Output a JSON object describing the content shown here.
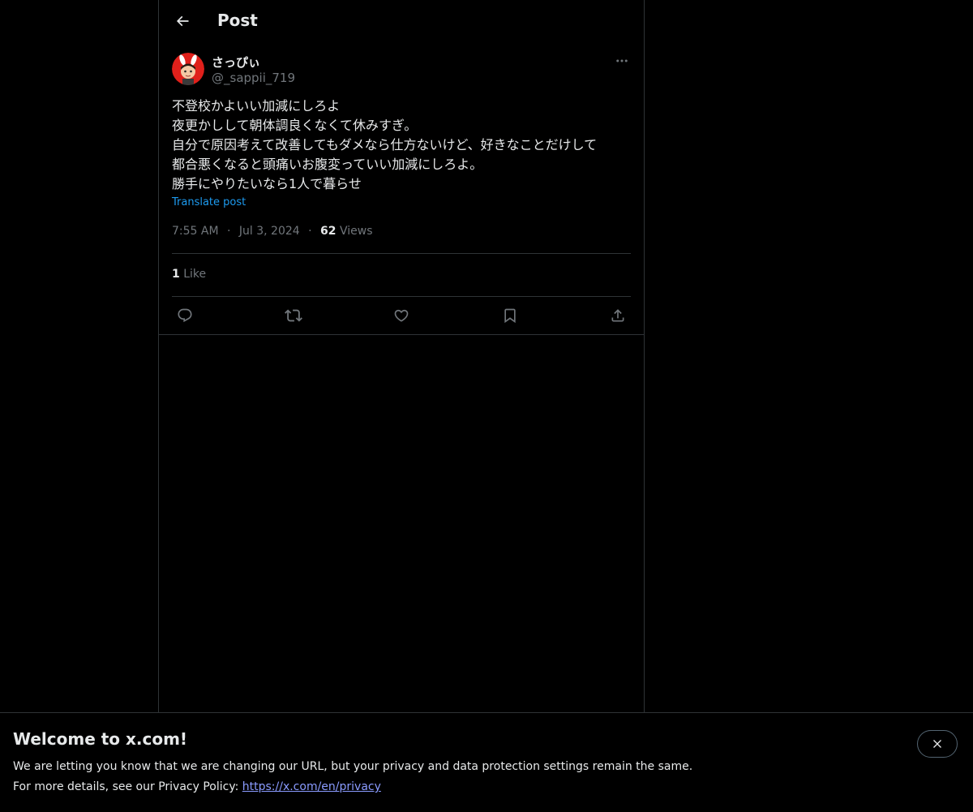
{
  "header": {
    "title": "Post"
  },
  "author": {
    "display_name": "さっぴぃ",
    "handle": "@_sappii_719"
  },
  "post": {
    "text": "不登校かよいい加減にしろよ\n夜更かしして朝体調良くなくて休みすぎ。\n自分で原因考えて改善してもダメなら仕方ないけど、好きなことだけして\n都合悪くなると頭痛いお腹変っていい加減にしろよ。\n勝手にやりたいなら1人で暮らせ",
    "translate_label": "Translate post",
    "time": "7:55 AM",
    "date": "Jul 3, 2024",
    "separator": "·",
    "views_count": "62",
    "views_label": "Views",
    "likes_count": "1",
    "likes_label": "Like"
  },
  "actions": [
    {
      "icon": "reply-icon"
    },
    {
      "icon": "repost-icon"
    },
    {
      "icon": "like-icon"
    },
    {
      "icon": "bookmark-icon"
    },
    {
      "icon": "share-icon"
    }
  ],
  "banner": {
    "title": "Welcome to x.com!",
    "line1": "We are letting you know that we are changing our URL, but your privacy and data protection settings remain the same.",
    "line2_prefix": "For more details, see our Privacy Policy:",
    "link_text": "https://x.com/en/privacy"
  },
  "colors": {
    "background": "#000000",
    "text": "#e7e9ea",
    "secondary_text": "#71767b",
    "accent": "#1d9bf0",
    "border": "#2f3336",
    "avatar_bg": "#e0201b"
  }
}
